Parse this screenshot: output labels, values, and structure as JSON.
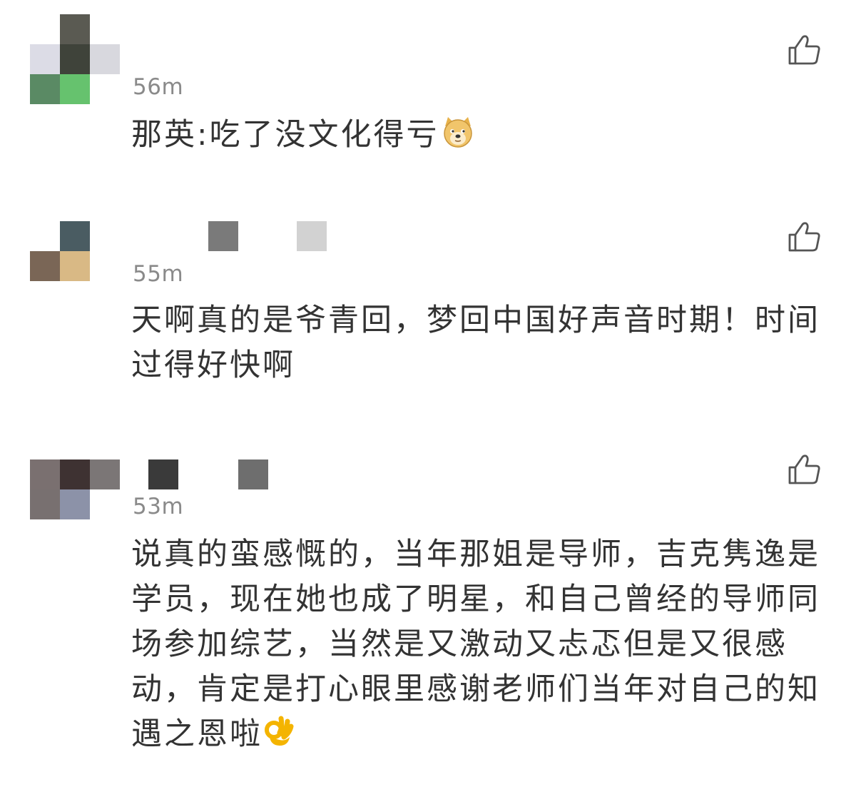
{
  "comments": [
    {
      "time": "56m",
      "text": "那英:吃了没文化得亏",
      "emoji": "doge-emoji"
    },
    {
      "time": "55m",
      "text": "天啊真的是爷青回，梦回中国好声音时期！时间过得好快啊"
    },
    {
      "time": "53m",
      "text": "说真的蛮感慨的，当年那姐是导师，吉克隽逸是学员，现在她也成了明星，和自己曾经的导师同场参加综艺，当然是又激动又忐忑但是又很感动，肯定是打心眼里感谢老师们当年对自己的知遇之恩啦",
      "emoji": "ok-hand-emoji"
    }
  ],
  "icons": {
    "like": "thumbs-up-icon"
  },
  "colors": {
    "text": "#333333",
    "time": "#8a8a8a",
    "like_icon": "#555555"
  }
}
